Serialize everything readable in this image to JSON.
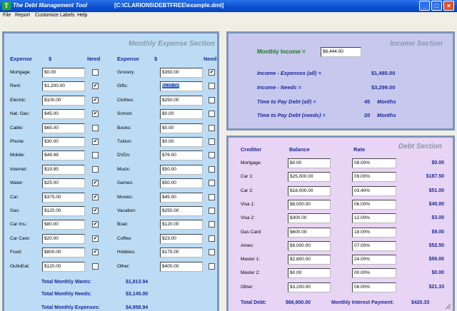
{
  "window": {
    "app_title": "The Debt Management Tool",
    "file_path": "[C:\\CLARION5\\DEBTFREE\\example.dmt]",
    "minimize": "_",
    "maximize": "□",
    "close": "×"
  },
  "menu": [
    "File",
    "Report",
    "Customize Labels",
    "Help"
  ],
  "expense": {
    "title": "Monthly Expense Section",
    "headers": {
      "expense": "Expense",
      "dollar": "$",
      "need": "Need"
    },
    "left": [
      {
        "label": "Mortgage:",
        "value": "$0.00",
        "need": false
      },
      {
        "label": "Rent:",
        "value": "$1,200.00",
        "need": true
      },
      {
        "label": "Electric:",
        "value": "$100.00",
        "need": true
      },
      {
        "label": "Nat. Gas:",
        "value": "$45.00",
        "need": true
      },
      {
        "label": "Cable:",
        "value": "$65.00",
        "need": false
      },
      {
        "label": "Phone:",
        "value": "$30.00",
        "need": true
      },
      {
        "label": "Mobile:",
        "value": "$49.99",
        "need": false
      },
      {
        "label": "Internet:",
        "value": "$19.95",
        "need": false
      },
      {
        "label": "Water:",
        "value": "$25.00",
        "need": true
      },
      {
        "label": "Car:",
        "value": "$375.00",
        "need": true
      },
      {
        "label": "Gas:",
        "value": "$120.00",
        "need": true
      },
      {
        "label": "Car Ins.:",
        "value": "$80.00",
        "need": true
      },
      {
        "label": "Car Care:",
        "value": "$20.00",
        "need": true
      },
      {
        "label": "Food:",
        "value": "$800.00",
        "need": true
      },
      {
        "label": "OuttoEat:",
        "value": "$120.00",
        "need": false
      }
    ],
    "right": [
      {
        "label": "Grocery:",
        "value": "$350.00",
        "need": true
      },
      {
        "label": "Gifts:",
        "value": "$120.00",
        "need": false
      },
      {
        "label": "Clothes:",
        "value": "$250.00",
        "need": false
      },
      {
        "label": "School:",
        "value": "$0.00",
        "need": false
      },
      {
        "label": "Books:",
        "value": "$0.00",
        "need": false
      },
      {
        "label": "Tuition:",
        "value": "$0.00",
        "need": false
      },
      {
        "label": "DVDs:",
        "value": "$76.00",
        "need": false
      },
      {
        "label": "Music:",
        "value": "$50.00",
        "need": false
      },
      {
        "label": "Games:",
        "value": "$50.00",
        "need": false
      },
      {
        "label": "Movies:",
        "value": "$45.00",
        "need": false
      },
      {
        "label": "Vacation:",
        "value": "$250.00",
        "need": false
      },
      {
        "label": "Boat:",
        "value": "$120.00",
        "need": false
      },
      {
        "label": "Coffee:",
        "value": "$23.00",
        "need": false
      },
      {
        "label": "Hobbies:",
        "value": "$175.00",
        "need": false
      },
      {
        "label": "Other:",
        "value": "$400.00",
        "need": false
      }
    ],
    "selected_field": "Gifts:",
    "totals": [
      {
        "label": "Total Monthly Wants:",
        "value": "$1,813.94"
      },
      {
        "label": "Total Monthly Needs:",
        "value": "$3,145.00"
      },
      {
        "label": "Total Monthly Expenses:",
        "value": "$4,958.94"
      }
    ]
  },
  "income": {
    "title": "Income Section",
    "monthly_label": "Monthly Income =",
    "monthly_value": "$6,444.00",
    "rows": [
      {
        "label": "Income - Expenses (all) =",
        "value": "$1,485.00",
        "unit": ""
      },
      {
        "label": "Income - Needs =",
        "value": "$3,299.00",
        "unit": ""
      },
      {
        "label": "Time to Pay Debt (all) =",
        "value": "45",
        "unit": "Months"
      },
      {
        "label": "Time to Pay Debt (needs) =",
        "value": "20",
        "unit": "Months"
      }
    ]
  },
  "debt": {
    "title": "Debt Section",
    "headers": {
      "creditor": "Creditor",
      "balance": "Balance",
      "rate": "Rate"
    },
    "rows": [
      {
        "label": "Mortgage:",
        "balance": "$0.00",
        "rate": "08.00%",
        "payment": "$0.00"
      },
      {
        "label": "Car 1:",
        "balance": "$25,000.00",
        "rate": "09.00%",
        "payment": "$187.50"
      },
      {
        "label": "Car 2:",
        "balance": "$18,000.00",
        "rate": "03.40%",
        "payment": "$51.00"
      },
      {
        "label": "Visa 1:",
        "balance": "$8,000.00",
        "rate": "06.00%",
        "payment": "$40.00"
      },
      {
        "label": "Visa 2:",
        "balance": "$300.00",
        "rate": "12.00%",
        "payment": "$3.00"
      },
      {
        "label": "Gas Card:",
        "balance": "$600.00",
        "rate": "18.00%",
        "payment": "$9.00"
      },
      {
        "label": "Amex:",
        "balance": "$9,000.00",
        "rate": "07.00%",
        "payment": "$52.50"
      },
      {
        "label": "Master 1:",
        "balance": "$2,800.00",
        "rate": "24.00%",
        "payment": "$56.00"
      },
      {
        "label": "Master 2:",
        "balance": "$0.00",
        "rate": "00.00%",
        "payment": "$0.00"
      },
      {
        "label": "Other:",
        "balance": "$3,200.00",
        "rate": "08.00%",
        "payment": "$21.33"
      }
    ],
    "total_debt_label": "Total Debt:",
    "total_debt_value": "$66,900.00",
    "interest_label": "Monthly Interest Payment:",
    "interest_value": "$420.33"
  }
}
